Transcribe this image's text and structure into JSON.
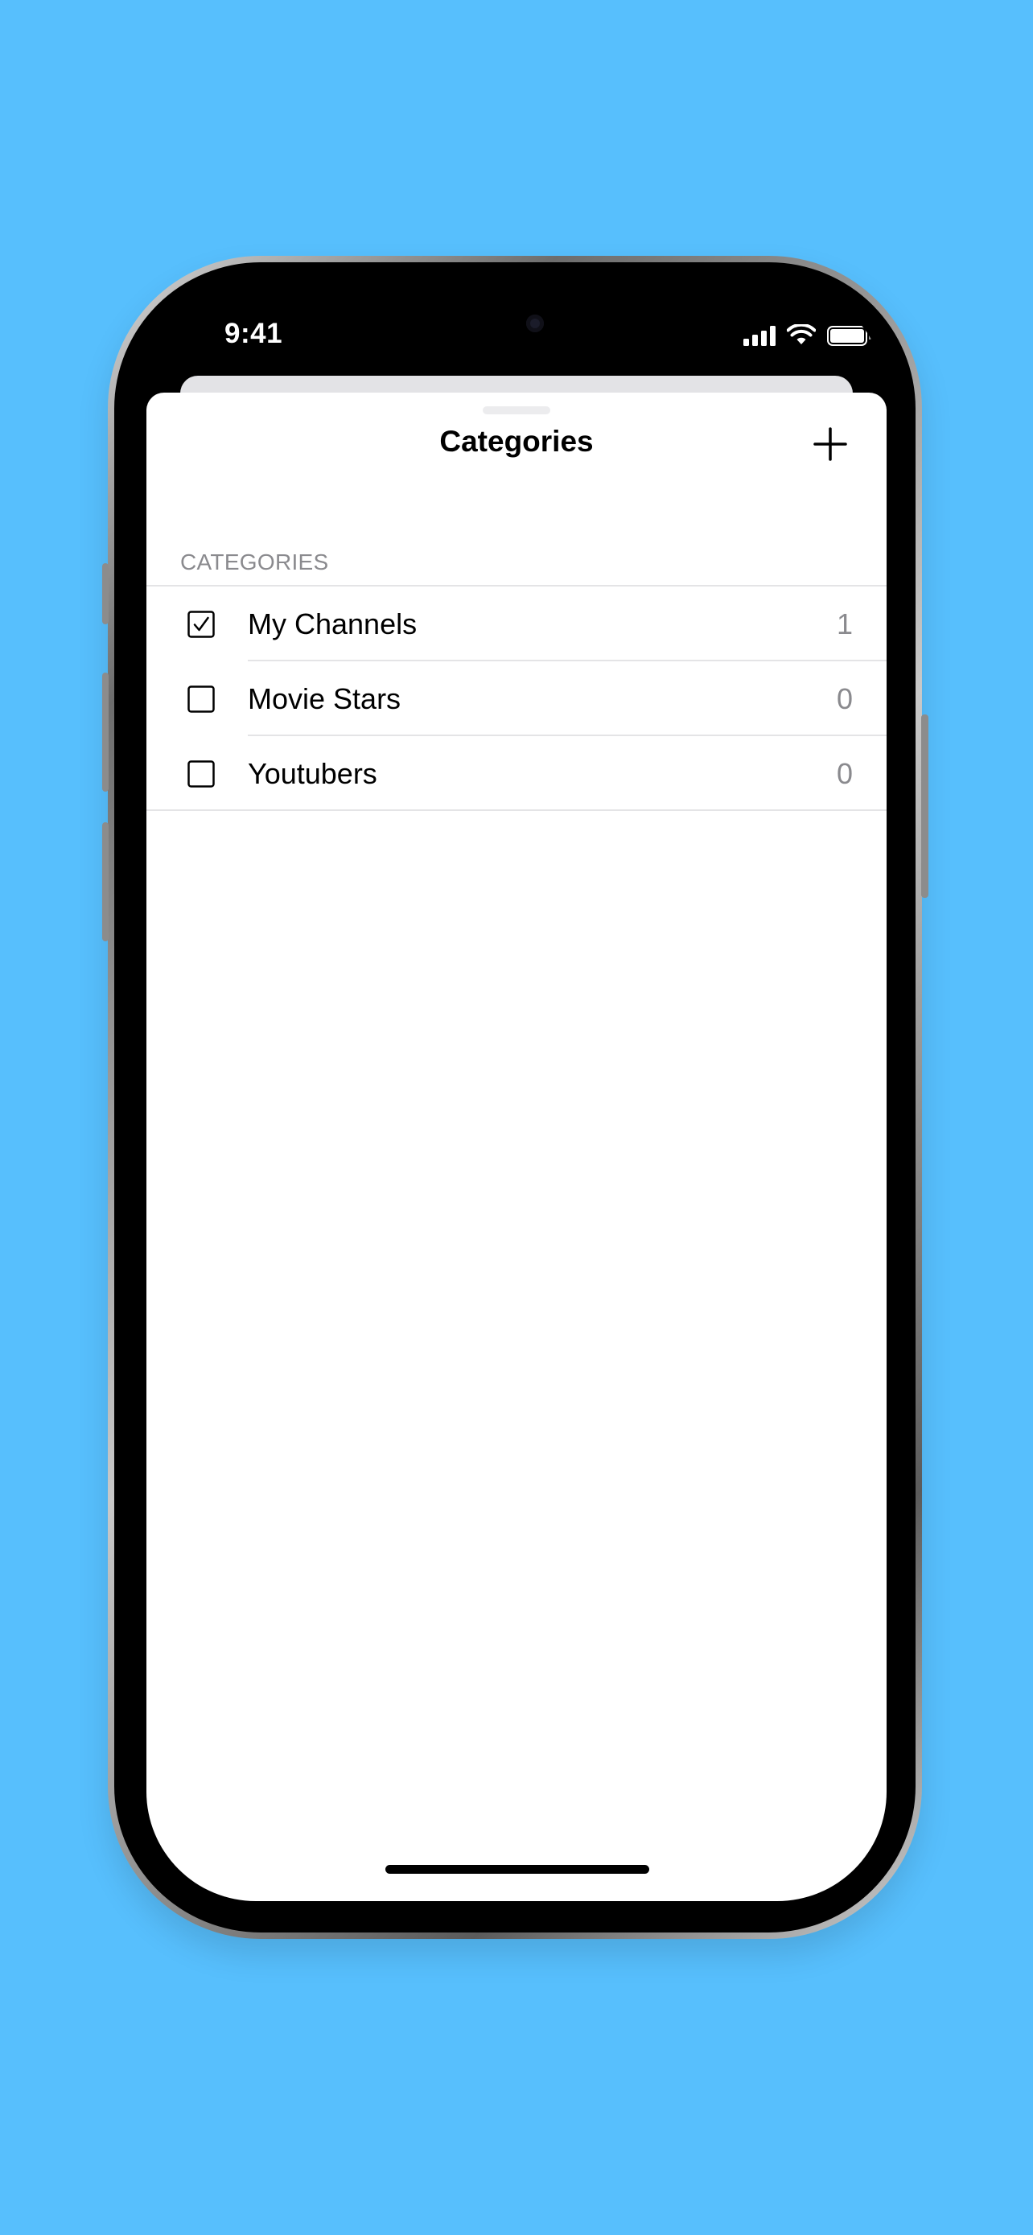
{
  "status_bar": {
    "time": "9:41"
  },
  "sheet": {
    "title": "Categories",
    "add_icon": "plus-icon"
  },
  "section": {
    "header": "CATEGORIES"
  },
  "categories": [
    {
      "label": "My Channels",
      "count": "1",
      "checked": true
    },
    {
      "label": "Movie Stars",
      "count": "0",
      "checked": false
    },
    {
      "label": "Youtubers",
      "count": "0",
      "checked": false
    }
  ],
  "colors": {
    "background": "#57bffd",
    "secondary_text": "#8a8a8e",
    "separator": "#e4e4e6"
  }
}
